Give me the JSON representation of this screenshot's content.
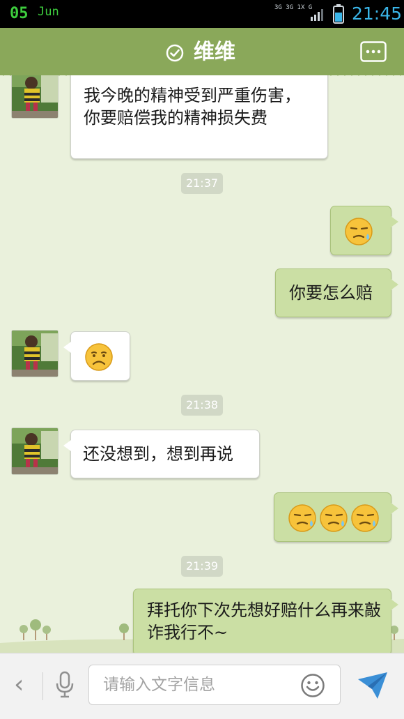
{
  "status_bar": {
    "date": "05",
    "month": "Jun",
    "network_labels": [
      "3G",
      "3G",
      "1X",
      "G"
    ],
    "time": "21:45"
  },
  "header": {
    "title": "维维",
    "title_icon": "check-circle-icon",
    "menu_icon": "more-dots-icon"
  },
  "messages": [
    {
      "kind": "text",
      "side": "in",
      "text": "我今晚的精神受到严重伤害，你要赔偿我的精神损失费"
    },
    {
      "kind": "timestamp",
      "text": "21:37"
    },
    {
      "kind": "emoji",
      "side": "out",
      "emoji": [
        "sweat-cry-face"
      ]
    },
    {
      "kind": "text",
      "side": "out",
      "text": "你要怎么赔"
    },
    {
      "kind": "emoji",
      "side": "in",
      "emoji": [
        "frown-face"
      ]
    },
    {
      "kind": "timestamp",
      "text": "21:38"
    },
    {
      "kind": "text",
      "side": "in",
      "text": "还没想到，想到再说"
    },
    {
      "kind": "emoji",
      "side": "out",
      "emoji": [
        "sweat-cry-face",
        "sweat-cry-face",
        "sweat-cry-face"
      ]
    },
    {
      "kind": "timestamp",
      "text": "21:39"
    },
    {
      "kind": "text",
      "side": "out",
      "text": "拜托你下次先想好赔什么再来敲诈我行不~"
    }
  ],
  "input_bar": {
    "placeholder": "请输入文字信息",
    "value": "",
    "icons": [
      "chevron-left-icon",
      "microphone-icon",
      "smiley-icon",
      "send-icon"
    ]
  },
  "colors": {
    "header": "#8aa85a",
    "background": "#eaf1dc",
    "bubble_out": "#cbdfa4",
    "bubble_in": "#ffffff",
    "clock": "#3ab5e8",
    "date": "#3dcc3d"
  }
}
